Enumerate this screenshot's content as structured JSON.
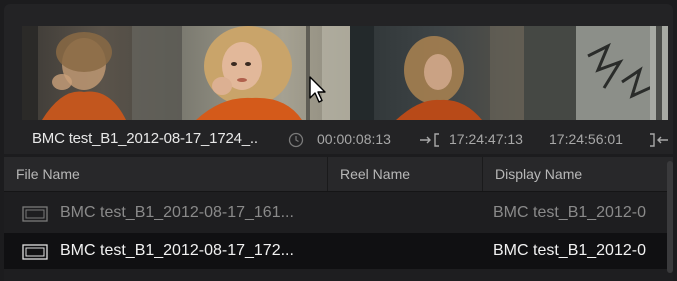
{
  "preview": {
    "clip_name": "BMC test_B1_2012-08-17_1724_..",
    "duration": "00:00:08:13",
    "in_timecode": "17:24:47:13",
    "out_timecode": "17:24:56:01"
  },
  "table": {
    "headers": [
      "File Name",
      "Reel Name",
      "Display Name"
    ],
    "rows": [
      {
        "file_name": "BMC test_B1_2012-08-17_161...",
        "reel_name": "",
        "display_name": "BMC test_B1_2012-0",
        "selected": false
      },
      {
        "file_name": "BMC test_B1_2012-08-17_172...",
        "reel_name": "",
        "display_name": "BMC test_B1_2012-0",
        "selected": true
      }
    ]
  },
  "icons": {
    "clock": "clock-icon",
    "in_point": "in-point-icon",
    "out_point": "out-point-icon",
    "clip": "video-clip-icon",
    "pointer": "mouse-pointer-icon"
  },
  "colors": {
    "background": "#1c1c1e",
    "header": "#28282a",
    "selected_row": "#101012",
    "text_primary": "#f2f2f2",
    "text_dim": "#8a8a8a"
  }
}
